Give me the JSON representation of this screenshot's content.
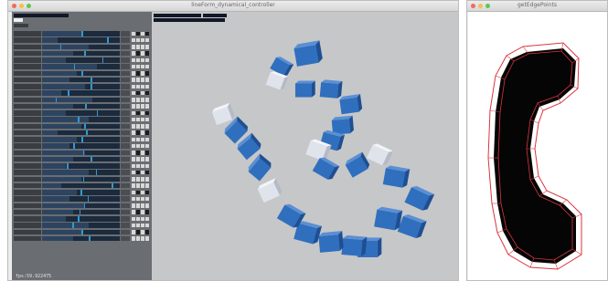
{
  "window_main": {
    "title": "lineForm_dynamical_controller",
    "fps_label": "fps:59.922475"
  },
  "window_edges": {
    "title": "getEdgePoints"
  },
  "colors": {
    "panel_bg": "#6a6d72",
    "viewport_bg": "#c6c7c8",
    "cube_blue": "#2f6fbe",
    "cube_pale": "#dfe3ec",
    "slider_marker": "#2e9bd6",
    "outline_red": "#d9363e"
  },
  "icons": [
    "close-dot",
    "minimize-dot",
    "zoom-dot",
    "phone-handset-shape"
  ],
  "controls": {
    "slider_count": 32
  }
}
